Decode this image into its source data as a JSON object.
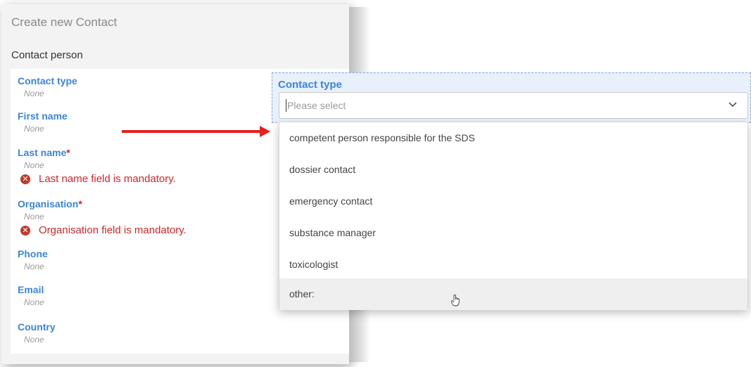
{
  "panel": {
    "title": "Create new Contact",
    "section_title": "Contact person",
    "fields": [
      {
        "label": "Contact type",
        "required": false,
        "value": "None"
      },
      {
        "label": "First name",
        "required": false,
        "value": "None"
      },
      {
        "label": "Last name",
        "required": true,
        "value": "None",
        "error": "Last name field is mandatory."
      },
      {
        "label": "Organisation",
        "required": true,
        "value": "None",
        "error": "Organisation field is mandatory."
      },
      {
        "label": "Phone",
        "required": false,
        "value": "None"
      },
      {
        "label": "Email",
        "required": false,
        "value": "None"
      },
      {
        "label": "Country",
        "required": false,
        "value": "None"
      }
    ],
    "required_marker": "*",
    "error_icon": "x-circle-icon"
  },
  "popup": {
    "label": "Contact type",
    "placeholder": "Please select",
    "options": [
      "competent person responsible for the SDS",
      "dossier contact",
      "emergency contact",
      "substance manager",
      "toxicologist",
      "other:"
    ],
    "hovered_option": "other:",
    "chevron_icon": "chevron-down-icon"
  },
  "annotation": {
    "arrow_color": "#e8201e",
    "arrow_icon": "red-arrow-right"
  },
  "colors": {
    "label_blue": "#3b86d6",
    "error_red": "#c8282c"
  }
}
